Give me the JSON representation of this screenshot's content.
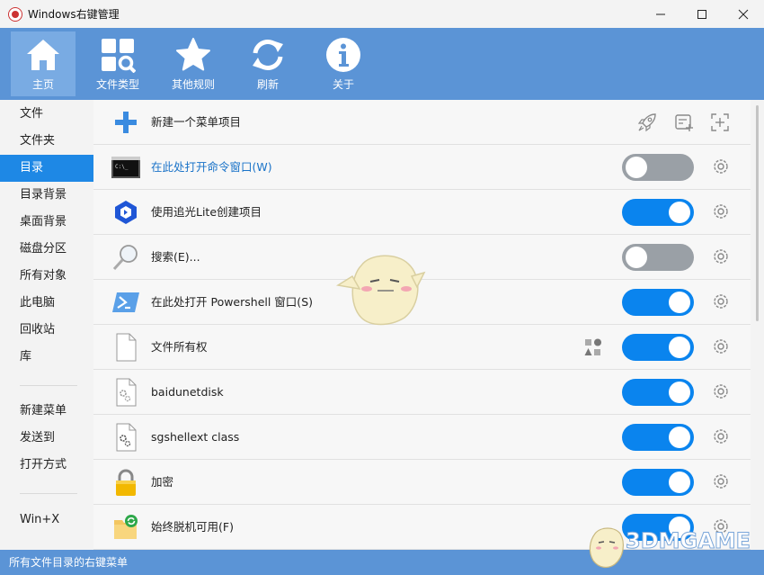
{
  "window": {
    "title": "Windows右键管理",
    "controls": {
      "minimize": "—",
      "maximize": "☐",
      "close": "✕"
    }
  },
  "toolbar": {
    "items": [
      {
        "label": "主页",
        "icon": "home-icon",
        "active": true
      },
      {
        "label": "文件类型",
        "icon": "file-type-icon",
        "active": false
      },
      {
        "label": "其他规则",
        "icon": "star-icon",
        "active": false
      },
      {
        "label": "刷新",
        "icon": "refresh-icon",
        "active": false
      },
      {
        "label": "关于",
        "icon": "info-icon",
        "active": false
      }
    ]
  },
  "sidebar": {
    "items": [
      {
        "label": "文件"
      },
      {
        "label": "文件夹"
      },
      {
        "label": "目录",
        "selected": true
      },
      {
        "label": "目录背景"
      },
      {
        "label": "桌面背景"
      },
      {
        "label": "磁盘分区"
      },
      {
        "label": "所有对象"
      },
      {
        "label": "此电脑"
      },
      {
        "label": "回收站"
      },
      {
        "label": "库"
      },
      {
        "label": "新建菜单"
      },
      {
        "label": "发送到"
      },
      {
        "label": "打开方式"
      },
      {
        "label": "Win+X"
      }
    ]
  },
  "content": {
    "new_item_label": "新建一个菜单项目",
    "header_icons": [
      "rocket-icon",
      "add-note-icon",
      "add-crosshair-icon"
    ],
    "rows": [
      {
        "label": "在此处打开命令窗口(W)",
        "icon": "cmd-icon",
        "enabled": false,
        "highlight": true
      },
      {
        "label": "使用追光Lite创建项目",
        "icon": "app-logo-icon",
        "enabled": true
      },
      {
        "label": "搜索(E)...",
        "icon": "magnifier-icon",
        "enabled": false
      },
      {
        "label": "在此处打开 Powershell 窗口(S)",
        "icon": "powershell-icon",
        "enabled": true
      },
      {
        "label": "文件所有权",
        "icon": "blank-file-icon",
        "enabled": true,
        "extra_icon": "shapes-icon"
      },
      {
        "label": "baidunetdisk",
        "icon": "gear-file-icon",
        "enabled": true
      },
      {
        "label": "sgshellext class",
        "icon": "gear-file-icon",
        "enabled": true
      },
      {
        "label": "加密",
        "icon": "lock-icon",
        "enabled": true
      },
      {
        "label": "始终脱机可用(F)",
        "icon": "sync-folder-icon",
        "enabled": true
      }
    ]
  },
  "status": {
    "text": "所有文件目录的右键菜单"
  },
  "watermark": {
    "text": "3DMGAME"
  },
  "colors": {
    "accent": "#5b94d6",
    "selected": "#1e88e5",
    "toggle_on": "#0a84ee",
    "toggle_off": "#9aa0a6"
  }
}
